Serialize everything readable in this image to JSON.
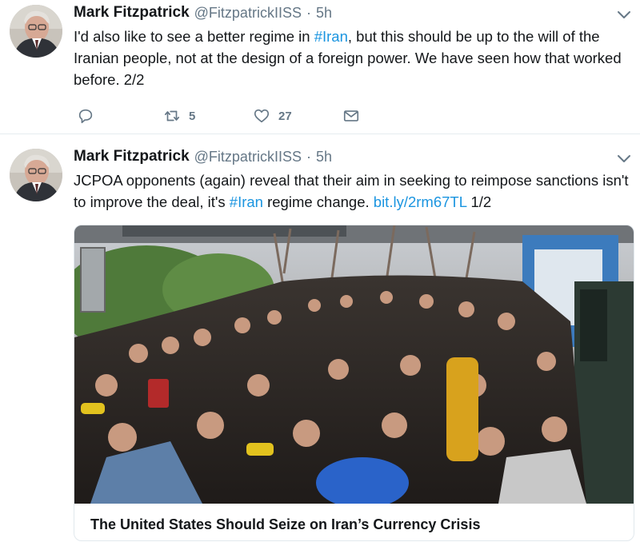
{
  "tweets": [
    {
      "author_name": "Mark Fitzpatrick",
      "handle": "@FitzpatrickIISS",
      "separator": "·",
      "time": "5h",
      "text_parts": {
        "a": "I'd also like to see a better regime in ",
        "hashtag": "#Iran",
        "b": ", but this should be up to the will of the Iranian people, not at the design of a foreign power.  We have seen how that worked before. 2/2"
      },
      "actions": {
        "reply_icon": "reply-icon",
        "retweet_icon": "retweet-icon",
        "retweet_count": "5",
        "like_icon": "heart-icon",
        "like_count": "27",
        "dm_icon": "envelope-icon"
      }
    },
    {
      "author_name": "Mark Fitzpatrick",
      "handle": "@FitzpatrickIISS",
      "separator": "·",
      "time": "5h",
      "text_parts": {
        "a": "JCPOA opponents (again) reveal that their aim in seeking to reimpose sanctions isn't to improve the deal, it's ",
        "hashtag": "#Iran",
        "b": " regime change. ",
        "link": "bit.ly/2rm67TL",
        "c": "  1/2"
      },
      "card": {
        "image_icon": "crowd-photo",
        "title": "The United States Should Seize on Iran’s Currency Crisis"
      }
    }
  ],
  "colors": {
    "text": "#14171a",
    "secondary": "#657786",
    "link": "#1b95e0",
    "border": "#e6ecf0"
  },
  "icons": {
    "caret": "chevron-down-icon"
  }
}
